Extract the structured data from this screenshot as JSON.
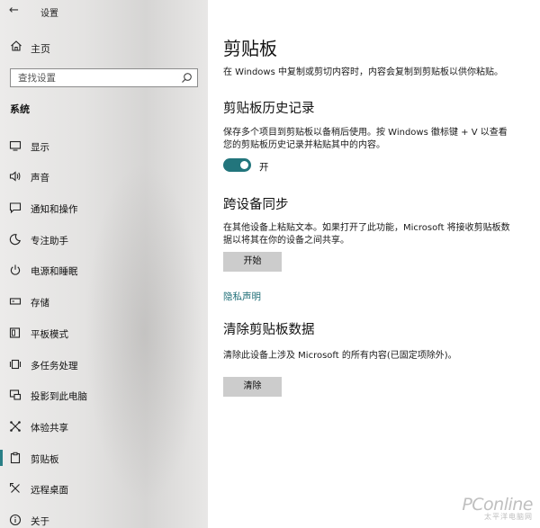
{
  "window": {
    "title": "设置"
  },
  "sidebar": {
    "home_label": "主页",
    "search_placeholder": "查找设置",
    "section_label": "系统",
    "items": [
      {
        "label": "显示",
        "icon": "display-icon"
      },
      {
        "label": "声音",
        "icon": "speaker-icon"
      },
      {
        "label": "通知和操作",
        "icon": "notification-icon"
      },
      {
        "label": "专注助手",
        "icon": "moon-icon"
      },
      {
        "label": "电源和睡眠",
        "icon": "power-icon"
      },
      {
        "label": "存储",
        "icon": "storage-icon"
      },
      {
        "label": "平板模式",
        "icon": "tablet-icon"
      },
      {
        "label": "多任务处理",
        "icon": "multitask-icon"
      },
      {
        "label": "投影到此电脑",
        "icon": "project-icon"
      },
      {
        "label": "体验共享",
        "icon": "share-icon"
      },
      {
        "label": "剪贴板",
        "icon": "clipboard-icon",
        "selected": true
      },
      {
        "label": "远程桌面",
        "icon": "remote-icon"
      },
      {
        "label": "关于",
        "icon": "info-icon"
      }
    ]
  },
  "main": {
    "title": "剪贴板",
    "intro": "在 Windows 中复制或剪切内容时，内容会复制到剪贴板以供你粘贴。",
    "history": {
      "heading": "剪贴板历史记录",
      "desc_line1": "保存多个项目到剪贴板以备稍后使用。按 Windows 徽标键 + V 以查看",
      "desc_line2": "您的剪贴板历史记录并粘贴其中的内容。",
      "toggle_state": "开"
    },
    "sync": {
      "heading": "跨设备同步",
      "desc_line1": "在其他设备上粘贴文本。如果打开了此功能，Microsoft 将接收剪贴板数",
      "desc_line2": "据以将其在你的设备之间共享。",
      "button_label": "开始"
    },
    "privacy_link": "隐私声明",
    "clear": {
      "heading": "清除剪贴板数据",
      "desc": "清除此设备上涉及 Microsoft 的所有内容(已固定项除外)。",
      "button_label": "清除"
    }
  },
  "watermark": {
    "main": "PConline",
    "sub": "太平洋电脑网"
  },
  "colors": {
    "accent": "#22757c",
    "link": "#1f6e77",
    "button": "#cccccc"
  }
}
